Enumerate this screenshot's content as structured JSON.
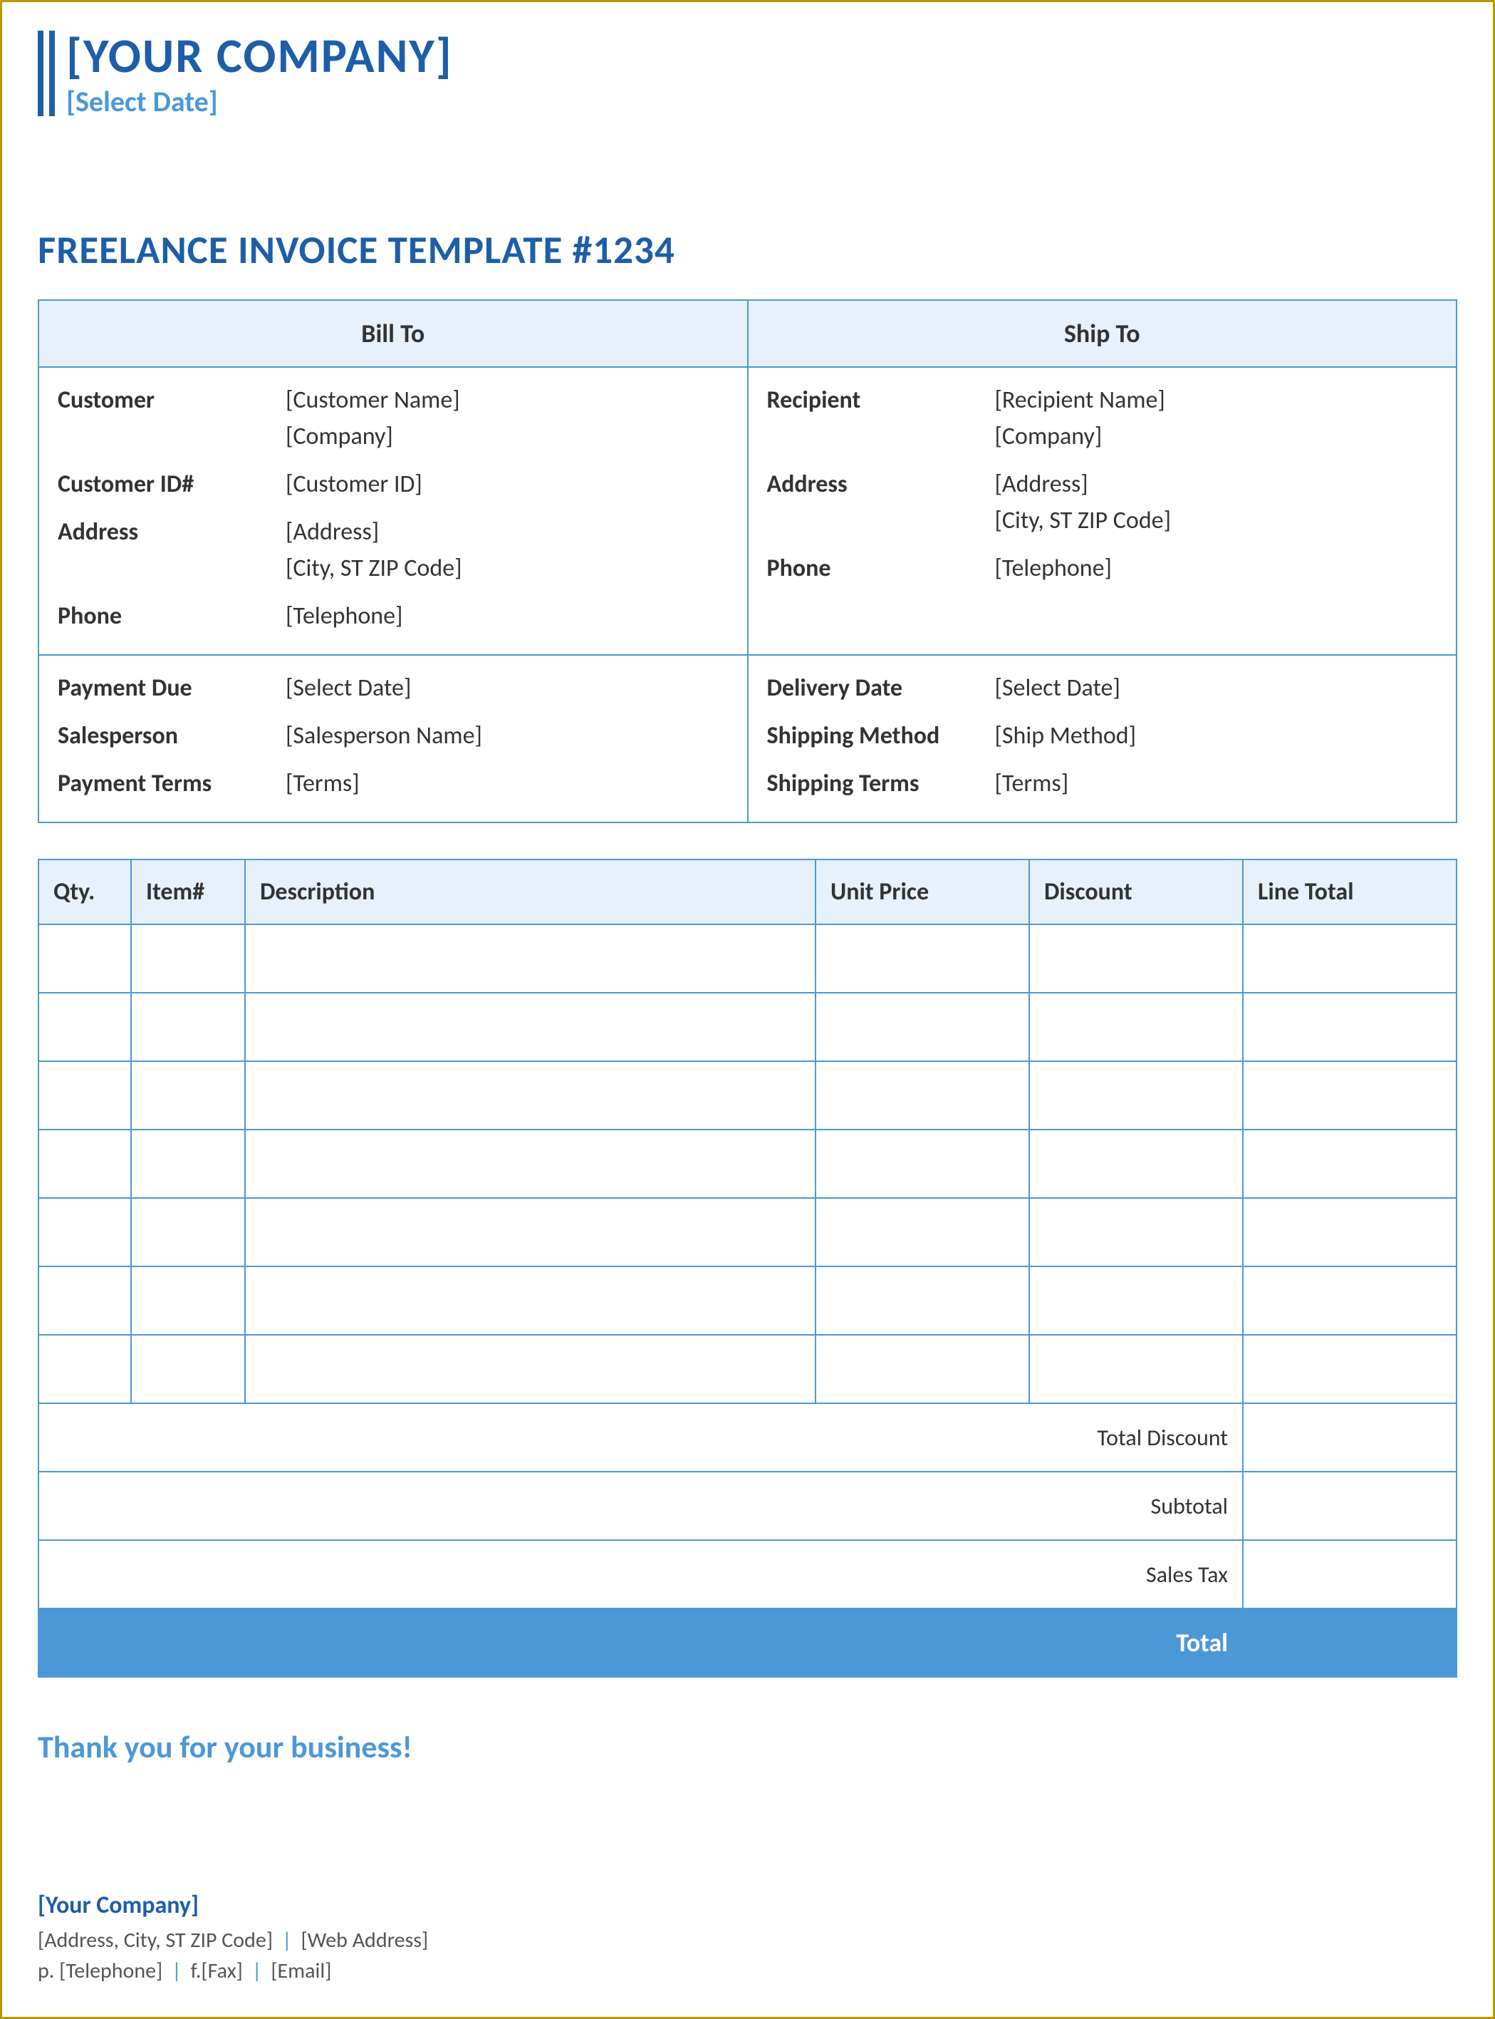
{
  "header": {
    "company": "[YOUR COMPANY]",
    "date": "[Select Date]"
  },
  "title": "FREELANCE INVOICE TEMPLATE #1234",
  "sections": {
    "bill_to": "Bill To",
    "ship_to": "Ship To"
  },
  "bill": {
    "customer_lbl": "Customer",
    "customer_name": "[Customer Name]",
    "customer_company": "[Company]",
    "customer_id_lbl": "Customer ID#",
    "customer_id": "[Customer ID]",
    "address_lbl": "Address",
    "address1": "[Address]",
    "address2": "[City, ST  ZIP Code]",
    "phone_lbl": "Phone",
    "phone": "[Telephone]"
  },
  "ship": {
    "recipient_lbl": "Recipient",
    "recipient_name": "[Recipient Name]",
    "recipient_company": "[Company]",
    "address_lbl": "Address",
    "address1": "[Address]",
    "address2": "[City, ST  ZIP Code]",
    "phone_lbl": "Phone",
    "phone": "[Telephone]"
  },
  "pay": {
    "due_lbl": "Payment Due",
    "due": "[Select Date]",
    "salesperson_lbl": "Salesperson",
    "salesperson": "[Salesperson Name]",
    "terms_lbl": "Payment Terms",
    "terms": "[Terms]"
  },
  "delivery": {
    "date_lbl": "Delivery Date",
    "date": "[Select Date]",
    "method_lbl": "Shipping Method",
    "method": "[Ship Method]",
    "terms_lbl": "Shipping Terms",
    "terms": "[Terms]"
  },
  "cols": {
    "qty": "Qty.",
    "item": "Item#",
    "desc": "Description",
    "unit": "Unit Price",
    "discount": "Discount",
    "line_total": "Line Total"
  },
  "summary": {
    "total_discount": "Total Discount",
    "subtotal": "Subtotal",
    "sales_tax": "Sales Tax",
    "total": "Total"
  },
  "thanks": "Thank you for your business!",
  "footer": {
    "company": "[Your Company]",
    "address": "[Address, City, ST  ZIP Code]",
    "web": "[Web Address]",
    "phone_prefix": "p. ",
    "phone": "[Telephone]",
    "fax_prefix": "f.",
    "fax": "[Fax]",
    "email": "[Email]"
  }
}
